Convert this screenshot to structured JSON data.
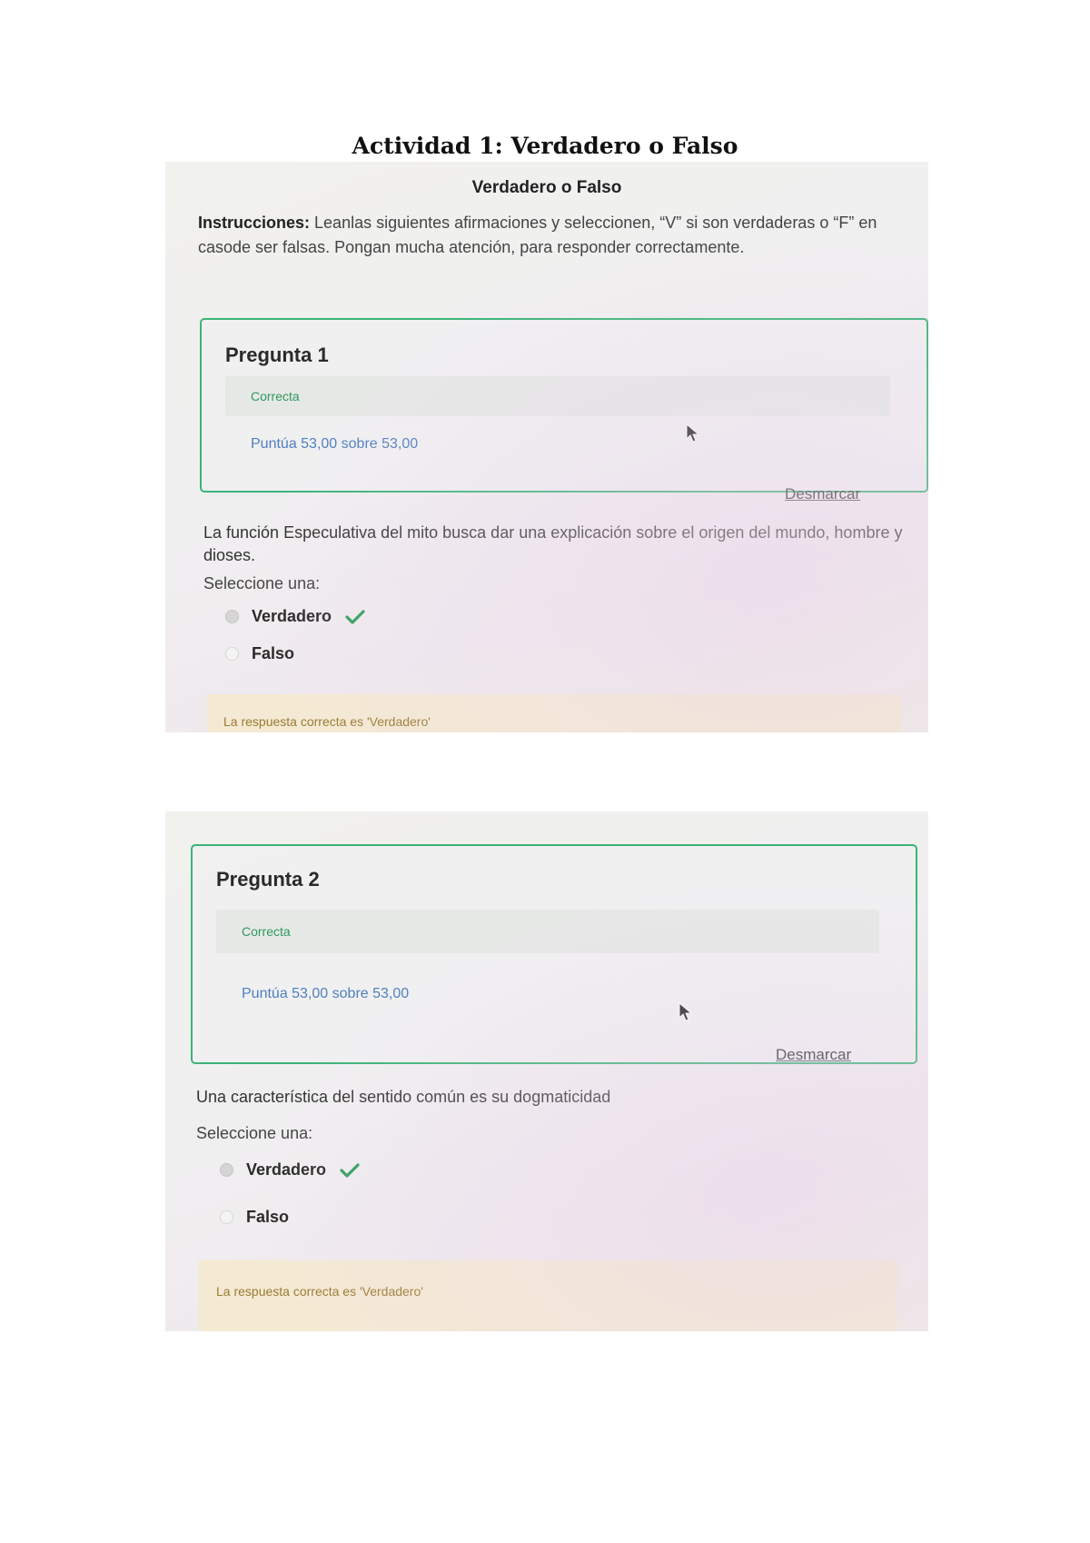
{
  "document": {
    "title": "Actividad 1: Verdadero o Falso"
  },
  "section": {
    "title": "Verdadero o Falso",
    "instructions_label": "Instrucciones:",
    "instructions_text": " Leanlas siguientes afirmaciones y seleccionen, “V” si son verdaderas o “F” en casode ser falsas. Pongan mucha atención, para responder correctamente."
  },
  "questions": [
    {
      "title": "Pregunta 1",
      "state": "Correcta",
      "grade": "Puntúa 53,00 sobre 53,00",
      "flag_label": "Desmarcar",
      "text": "La función Especulativa del mito busca dar una explicación sobre el origen del mundo, hombre y dioses.",
      "select_label": "Seleccione una:",
      "options": [
        {
          "label": "Verdadero",
          "selected": true,
          "correct_icon": "check-icon"
        },
        {
          "label": "Falso",
          "selected": false
        }
      ],
      "feedback": "La respuesta correcta es 'Verdadero'"
    },
    {
      "title": "Pregunta 2",
      "state": "Correcta",
      "grade": "Puntúa 53,00 sobre 53,00",
      "flag_label": "Desmarcar",
      "text": "Una característica del sentido común es su dogmaticidad",
      "select_label": "Seleccione una:",
      "options": [
        {
          "label": "Verdadero",
          "selected": true,
          "correct_icon": "check-icon"
        },
        {
          "label": "Falso",
          "selected": false
        }
      ],
      "feedback": "La respuesta correcta es 'Verdadero'"
    }
  ],
  "colors": {
    "box_border": "#3bb478",
    "state_text": "#2f9a5c",
    "grade_text": "#4f7fc0",
    "feedback_bg": "#f4ead3",
    "feedback_text": "#9a7a33",
    "check": "#2e9e5b"
  }
}
